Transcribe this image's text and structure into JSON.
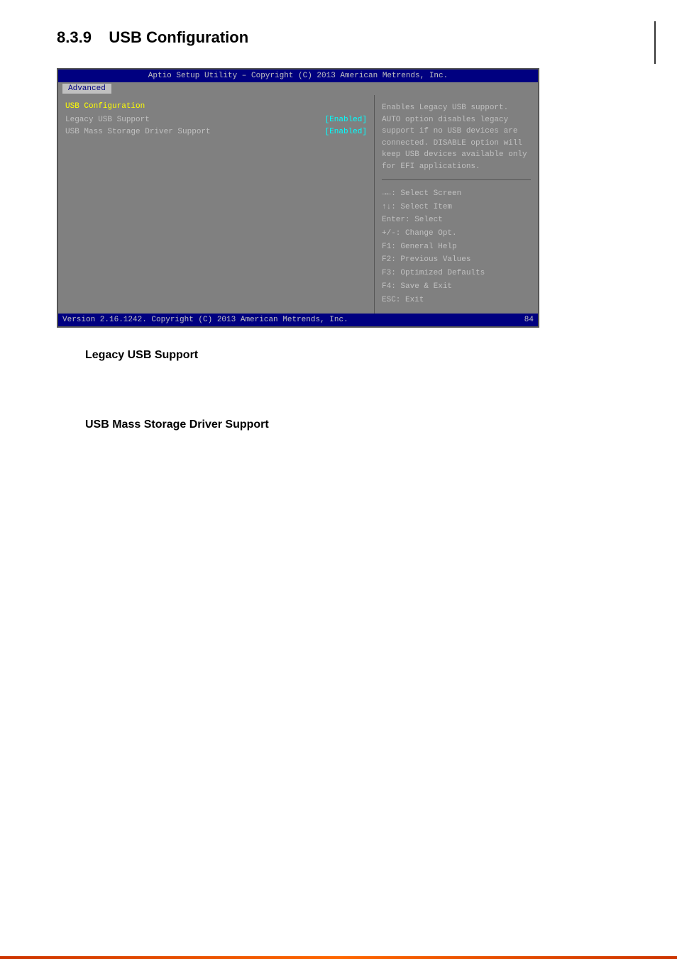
{
  "page": {
    "right_border": true
  },
  "section": {
    "number": "8.3.9",
    "title": "USB Configuration"
  },
  "bios": {
    "title_bar": "Aptio Setup Utility – Copyright (C) 2013 American Metrends, Inc.",
    "nav_items": [
      {
        "label": "Advanced",
        "active": true
      }
    ],
    "left_panel": {
      "section_label": "USB Configuration",
      "menu_items": [
        {
          "label": "Legacy USB Support",
          "value": "[Enabled]",
          "highlighted": false
        },
        {
          "label": "USB Mass Storage Driver Support",
          "value": "[Enabled]",
          "highlighted": false
        }
      ]
    },
    "right_panel": {
      "help_text": "Enables Legacy USB support. AUTO option disables legacy support if no USB devices are connected. DISABLE option will keep USB devices available only for EFI applications.",
      "key_help_lines": [
        "→←: Select Screen",
        "↑↓: Select Item",
        "Enter: Select",
        "+/-: Change Opt.",
        "F1: General Help",
        "F2: Previous Values",
        "F3: Optimized Defaults",
        "F4: Save & Exit",
        "ESC: Exit"
      ]
    },
    "footer": {
      "version_text": "Version 2.16.1242. Copyright (C) 2013 American Metrends, Inc.",
      "page_num": "84"
    }
  },
  "body_sections": [
    {
      "id": "legacy-usb-support",
      "heading": "Legacy USB Support",
      "text": ""
    },
    {
      "id": "usb-mass-storage",
      "heading": "USB Mass Storage Driver Support",
      "text": ""
    }
  ]
}
